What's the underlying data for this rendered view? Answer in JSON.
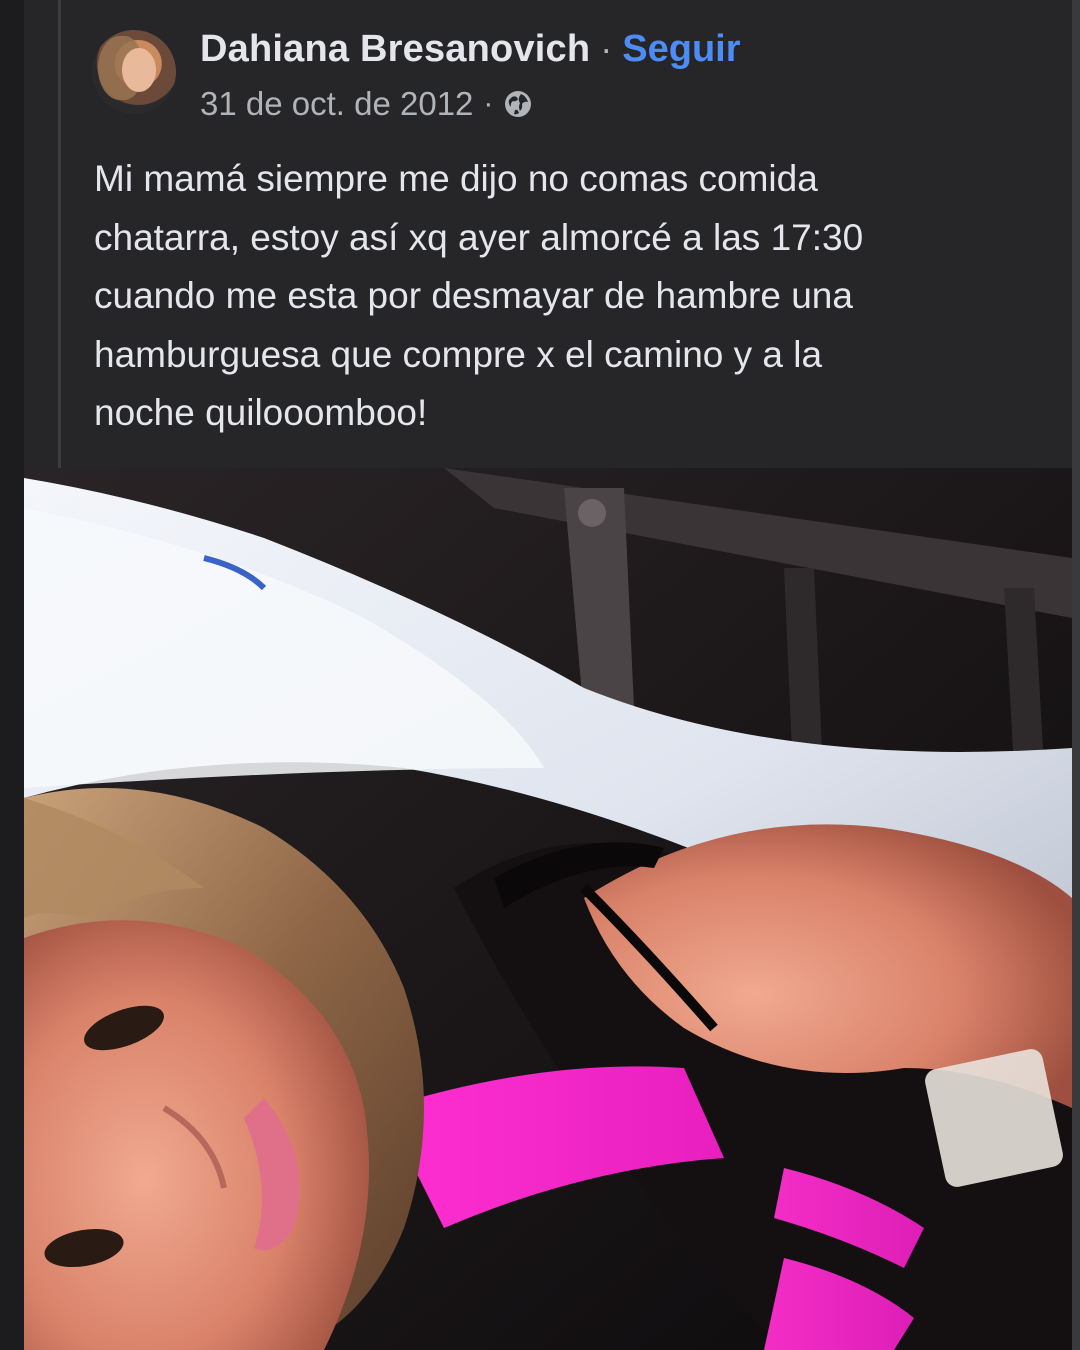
{
  "post": {
    "author": "Dahiana Bresanovich",
    "separator": "·",
    "follow_label": "Seguir",
    "date": "31 de oct. de 2012",
    "meta_separator": "·",
    "audience_icon": "globe-icon",
    "text": "Mi mamá siempre me dijo no comas comida\nchatarra, estoy así xq ayer almorcé a las 17:30\ncuando me esta por desmayar de hambre una\nhamburguesa que compre x el camino y a la\nnoche quilooomboo!"
  },
  "colors": {
    "background": "#262628",
    "text_primary": "#e4e6eb",
    "text_secondary": "#b0b3b8",
    "link": "#4c8df5"
  }
}
